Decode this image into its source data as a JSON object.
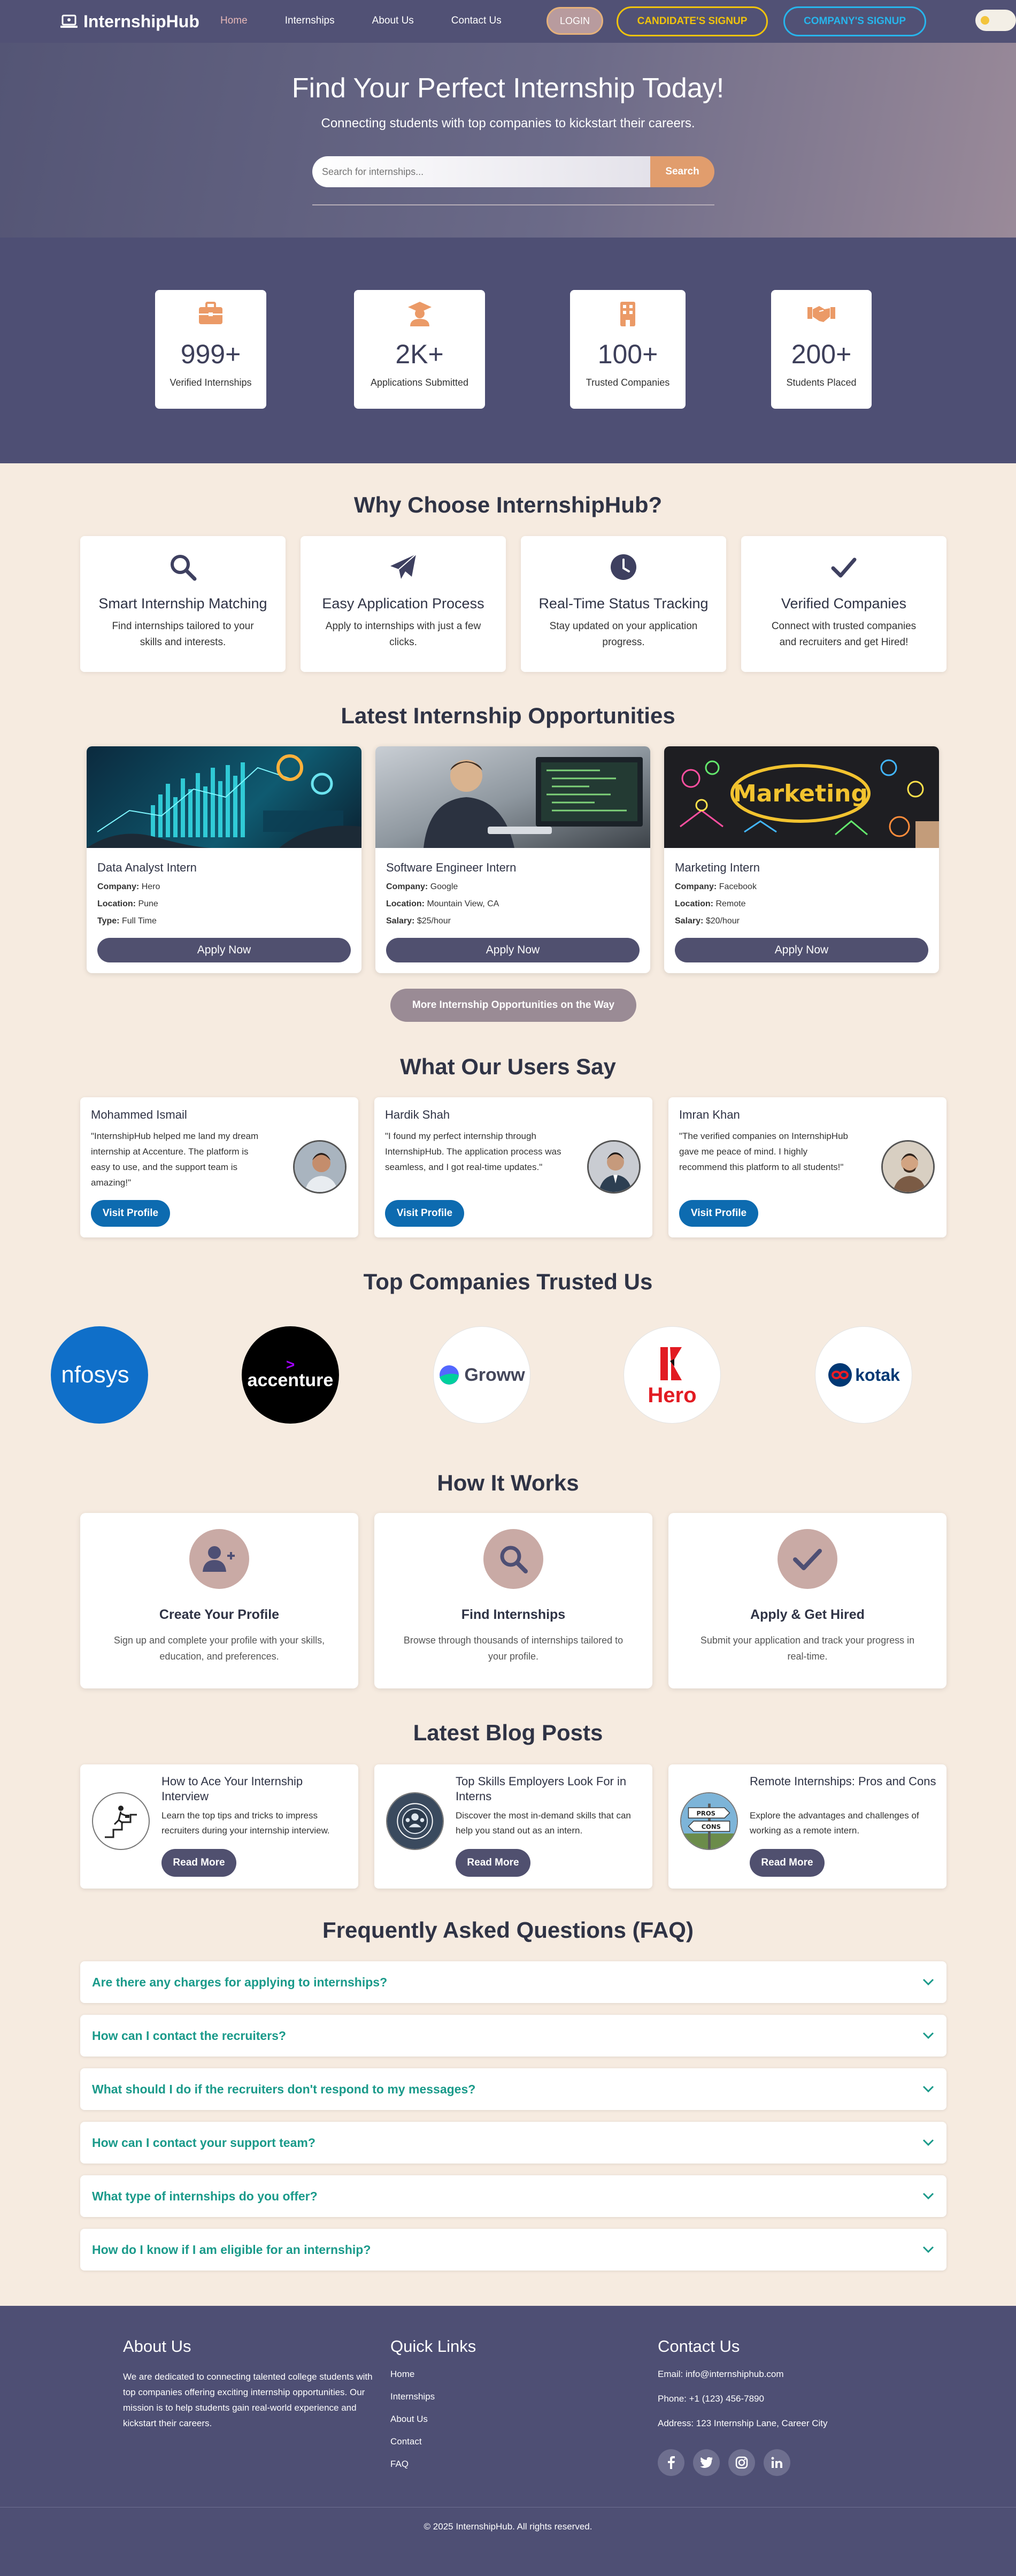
{
  "nav": {
    "brand": "InternshipHub",
    "links": [
      "Home",
      "Internships",
      "About Us",
      "Contact Us"
    ],
    "login": "LOGIN",
    "candidate_signup": "CANDIDATE'S SIGNUP",
    "company_signup": "COMPANY'S SIGNUP"
  },
  "hero": {
    "title": "Find Your Perfect Internship Today!",
    "subtitle": "Connecting students with top companies to kickstart their careers.",
    "search_placeholder": "Search for internships...",
    "search_button": "Search"
  },
  "stats": [
    {
      "icon": "briefcase-icon",
      "value": "999+",
      "label": "Verified Internships"
    },
    {
      "icon": "graduate-icon",
      "value": "2K+",
      "label": "Applications Submitted"
    },
    {
      "icon": "building-icon",
      "value": "100+",
      "label": "Trusted Companies"
    },
    {
      "icon": "handshake-icon",
      "value": "200+",
      "label": "Students Placed"
    }
  ],
  "why": {
    "title": "Why Choose InternshipHub?",
    "features": [
      {
        "icon": "search-icon",
        "title": "Smart Internship Matching",
        "text": "Find internships tailored to your skills and interests."
      },
      {
        "icon": "paper-plane-icon",
        "title": "Easy Application Process",
        "text": "Apply to internships with just a few clicks."
      },
      {
        "icon": "clock-icon",
        "title": "Real-Time Status Tracking",
        "text": "Stay updated on your application progress."
      },
      {
        "icon": "check-icon",
        "title": "Verified Companies",
        "text": "Connect with trusted companies and recruiters and get Hired!"
      }
    ]
  },
  "internships": {
    "title": "Latest Internship Opportunities",
    "items": [
      {
        "title": "Data Analyst Intern",
        "company_label": "Company:",
        "company": "Hero",
        "location_label": "Location:",
        "location": "Pune",
        "extra_label": "Type:",
        "extra": "Full Time"
      },
      {
        "title": "Software Engineer Intern",
        "company_label": "Company:",
        "company": "Google",
        "location_label": "Location:",
        "location": "Mountain View, CA",
        "extra_label": "Salary:",
        "extra": "$25/hour"
      },
      {
        "title": "Marketing Intern",
        "company_label": "Company:",
        "company": "Facebook",
        "location_label": "Location:",
        "location": "Remote",
        "extra_label": "Salary:",
        "extra": "$20/hour",
        "image_text": "Marketing"
      }
    ],
    "apply_label": "Apply Now",
    "more_button": "More Internship Opportunities on the Way"
  },
  "testimonials": {
    "title": "What Our Users Say",
    "items": [
      {
        "name": "Mohammed Ismail",
        "quote": "\"InternshipHub helped me land my dream internship at Accenture. The platform is easy to use, and the support team is amazing!\""
      },
      {
        "name": "Hardik Shah",
        "quote": "\"I found my perfect internship through InternshipHub. The application process was seamless, and I got real-time updates.\""
      },
      {
        "name": "Imran Khan",
        "quote": "\"The verified companies on InternshipHub gave me peace of mind. I highly recommend this platform to all students!\""
      }
    ],
    "button": "Visit Profile"
  },
  "companies": {
    "title": "Top Companies Trusted Us",
    "logos": [
      "nfosys",
      "accenture",
      "Groww",
      "Hero",
      "kotak"
    ]
  },
  "how": {
    "title": "How It Works",
    "steps": [
      {
        "icon": "user-plus-icon",
        "title": "Create Your Profile",
        "text": "Sign up and complete your profile with your skills, education, and preferences."
      },
      {
        "icon": "search-icon",
        "title": "Find Internships",
        "text": "Browse through thousands of internships tailored to your profile."
      },
      {
        "icon": "check-icon",
        "title": "Apply & Get Hired",
        "text": "Submit your application and track your progress in real-time."
      }
    ]
  },
  "blog": {
    "title": "Latest Blog Posts",
    "posts": [
      {
        "icon": "stairs-icon",
        "title": "How to Ace Your Internship Interview",
        "text": "Learn the top tips and tricks to impress recruiters during your internship interview."
      },
      {
        "icon": "skills-icon",
        "title": "Top Skills Employers Look For in Interns",
        "text": "Discover the most in-demand skills that can help you stand out as an intern."
      },
      {
        "icon": "signpost-icon",
        "title": "Remote Internships: Pros and Cons",
        "text": "Explore the advantages and challenges of working as a remote intern.",
        "sign_top": "PROS",
        "sign_bottom": "CONS"
      }
    ],
    "button": "Read More"
  },
  "faq": {
    "title": "Frequently Asked Questions (FAQ)",
    "items": [
      "Are there any charges for applying to internships?",
      "How can I contact the recruiters?",
      "What should I do if the recruiters don't respond to my messages?",
      "How can I contact your support team?",
      "What type of internships do you offer?",
      "How do I know if I am eligible for an internship?"
    ]
  },
  "footer": {
    "about_title": "About Us",
    "about_text": "We are dedicated to connecting talented college students with top companies offering exciting internship opportunities. Our mission is to help students gain real-world experience and kickstart their careers.",
    "links_title": "Quick Links",
    "links": [
      "Home",
      "Internships",
      "About Us",
      "Contact",
      "FAQ"
    ],
    "contact_title": "Contact Us",
    "email": "Email: info@internshiphub.com",
    "phone": "Phone: +1 (123) 456-7890",
    "address": "Address: 123 Internship Lane, Career City",
    "social": [
      "facebook-icon",
      "twitter-icon",
      "instagram-icon",
      "linkedin-icon"
    ],
    "copyright": "© 2025 InternshipHub. All rights reserved."
  },
  "colors": {
    "primary": "#4e4f74",
    "accent": "#e19d6d",
    "background": "#f6ebe0",
    "faq_text": "#1a9a8a",
    "profile_button": "#0d6bb0"
  }
}
